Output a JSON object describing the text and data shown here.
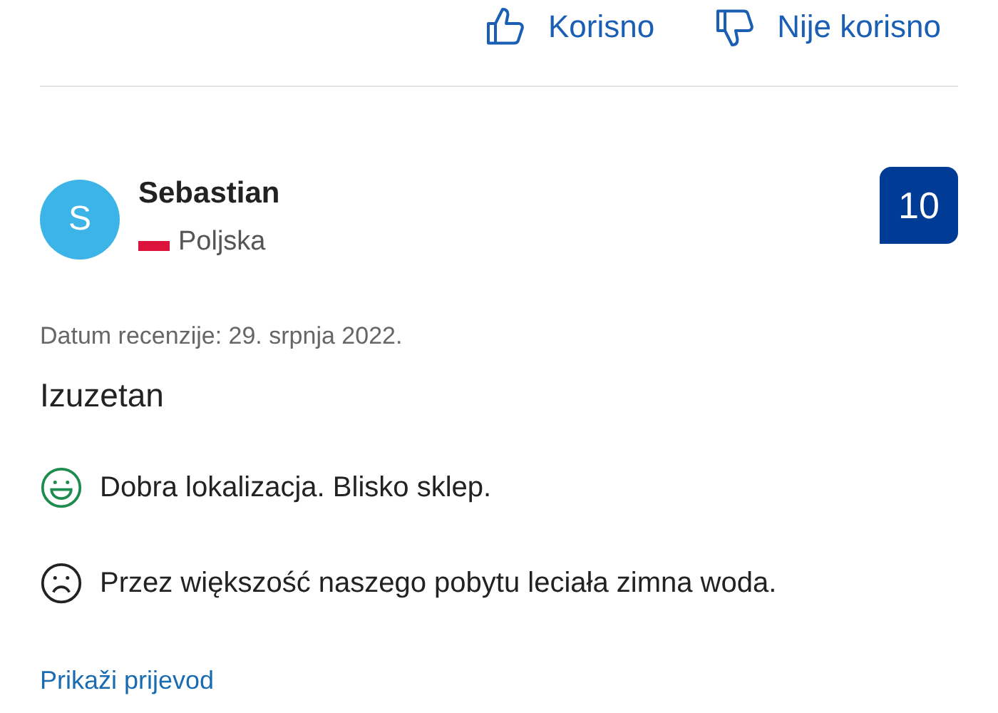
{
  "feedback_buttons": [
    {
      "label": "Korisno",
      "kind": "helpful"
    },
    {
      "label": "Nije korisno",
      "kind": "not_helpful"
    }
  ],
  "review": {
    "avatar_letter": "S",
    "name": "Sebastian",
    "country": "Poljska",
    "score": "10",
    "date": "Datum recenzije: 29. srpnja 2022.",
    "title": "Izuzetan",
    "comments": [
      {
        "kind": "positive",
        "text": "Dobra lokalizacja. Blisko sklep."
      },
      {
        "kind": "negative",
        "text": "Przez większość naszego pobytu leciała zimna woda."
      }
    ],
    "translate_link": "Prikaži prijevod"
  }
}
